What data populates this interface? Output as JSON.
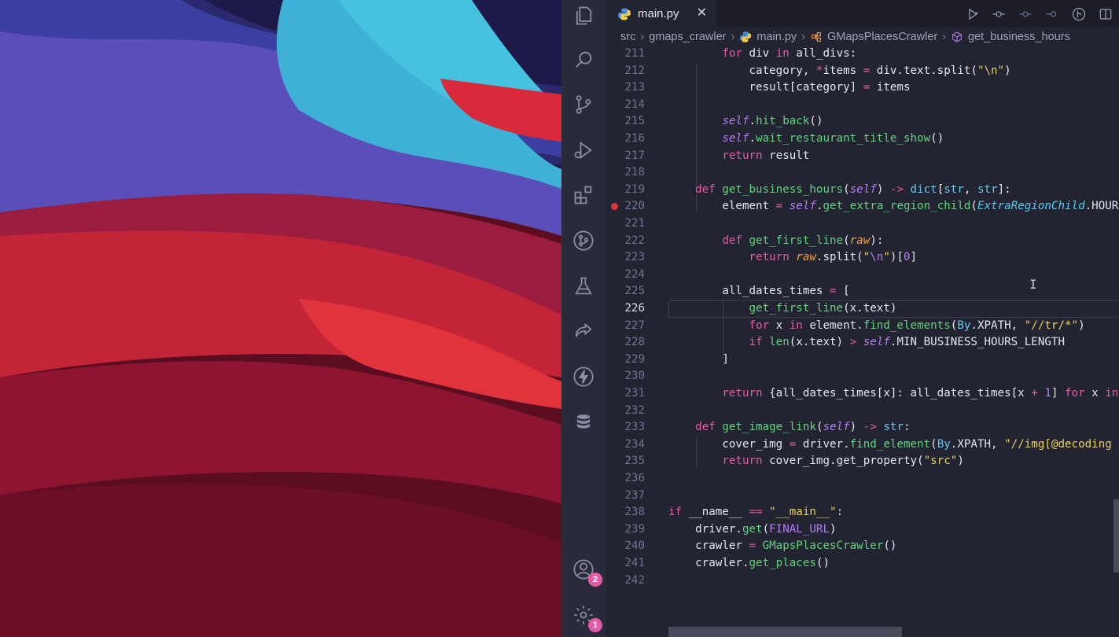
{
  "tab": {
    "label": "main.py",
    "close_glyph": "✕"
  },
  "breadcrumb": [
    "src",
    "gmaps_crawler",
    "main.py",
    "GMapsPlacesCrawler",
    "get_business_hours"
  ],
  "activity_bar": {
    "icons": [
      "explorer-icon",
      "search-icon",
      "source-control-icon",
      "run-debug-icon",
      "extensions-icon",
      "git-graph-icon",
      "testing-icon",
      "live-share-icon",
      "lightning-icon",
      "database-icon"
    ],
    "accounts_badge": "2",
    "settings_badge": "1"
  },
  "editor": {
    "lines": [
      {
        "n": "211",
        "html": "        <span class=\"k\">for</span> div <span class=\"k\">in</span> all_divs:"
      },
      {
        "n": "212",
        "html": "            category, <span class=\"k\">*</span>items <span class=\"k\">=</span> div.text.split(<span class=\"s\">\"\\n\"</span>)"
      },
      {
        "n": "213",
        "html": "            result[category] <span class=\"k\">=</span> items"
      },
      {
        "n": "214",
        "html": ""
      },
      {
        "n": "215",
        "html": "        <span class=\"sf\">self</span>.<span class=\"f\">hit_back</span>()"
      },
      {
        "n": "216",
        "html": "        <span class=\"sf\">self</span>.<span class=\"f\">wait_restaurant_title_show</span>()"
      },
      {
        "n": "217",
        "html": "        <span class=\"k\">return</span> result"
      },
      {
        "n": "218",
        "html": ""
      },
      {
        "n": "219",
        "html": "    <span class=\"k\">def</span> <span class=\"f\">get_business_hours</span>(<span class=\"sf\">self</span>) <span class=\"k\">-&gt;</span> <span class=\"b\">dict</span>[<span class=\"b\">str</span>, <span class=\"b\">str</span>]:"
      },
      {
        "n": "220",
        "html": "        element <span class=\"k\">=</span> <span class=\"sf\">self</span>.<span class=\"f\">get_extra_region_child</span>(<span class=\"cl\">ExtraRegionChild</span>.HOURS)"
      },
      {
        "n": "221",
        "html": ""
      },
      {
        "n": "222",
        "html": "        <span class=\"k\">def</span> <span class=\"f\">get_first_line</span>(<span class=\"pa\">raw</span>):"
      },
      {
        "n": "223",
        "html": "            <span class=\"k\">return</span> <span class=\"pa\">raw</span>.split(<span class=\"s\">\"</span><span class=\"cst\">\\n</span><span class=\"s\">\"</span>)[<span class=\"n\">0</span>]"
      },
      {
        "n": "224",
        "html": ""
      },
      {
        "n": "225",
        "html": "        all_dates_times <span class=\"k\">=</span> ["
      },
      {
        "n": "226",
        "html": "            <span class=\"f\">get_first_line</span>(x.text)"
      },
      {
        "n": "227",
        "html": "            <span class=\"k\">for</span> x <span class=\"k\">in</span> element.<span class=\"f\">find_elements</span>(<span class=\"b\">By</span>.XPATH, <span class=\"s\">\"//tr/*\"</span>)"
      },
      {
        "n": "228",
        "html": "            <span class=\"k\">if</span> <span class=\"f\">len</span>(x.text) <span class=\"k\">&gt;</span> <span class=\"sf\">self</span>.MIN_BUSINESS_HOURS_LENGTH"
      },
      {
        "n": "229",
        "html": "        ]"
      },
      {
        "n": "230",
        "html": ""
      },
      {
        "n": "231",
        "html": "        <span class=\"k\">return</span> {all_dates_times[x]: all_dates_times[x <span class=\"k\">+</span> <span class=\"n\">1</span>] <span class=\"k\">for</span> x <span class=\"k\">in</span>"
      },
      {
        "n": "232",
        "html": ""
      },
      {
        "n": "233",
        "html": "    <span class=\"k\">def</span> <span class=\"f\">get_image_link</span>(<span class=\"sf\">self</span>) <span class=\"k\">-&gt;</span> <span class=\"b\">str</span>:"
      },
      {
        "n": "234",
        "html": "        cover_img <span class=\"k\">=</span> driver.<span class=\"f\">find_element</span>(<span class=\"b\">By</span>.XPATH, <span class=\"s\">\"//img[@decoding</span>"
      },
      {
        "n": "235",
        "html": "        <span class=\"k\">return</span> cover_img.get_property(<span class=\"s\">\"src\"</span>)"
      },
      {
        "n": "236",
        "html": ""
      },
      {
        "n": "237",
        "html": ""
      },
      {
        "n": "238",
        "html": "<span class=\"k\">if</span> __name__ <span class=\"k\">==</span> <span class=\"s\">\"__main__\"</span>:"
      },
      {
        "n": "239",
        "html": "    driver.<span class=\"f\">get</span>(<span class=\"cst\">FINAL_URL</span>)"
      },
      {
        "n": "240",
        "html": "    crawler <span class=\"k\">=</span> <span class=\"g\">GMapsPlacesCrawler</span>()"
      },
      {
        "n": "241",
        "html": "    crawler.<span class=\"f\">get_places</span>()"
      },
      {
        "n": "242",
        "html": ""
      }
    ],
    "active_line": "226",
    "breakpoint_line": "220"
  },
  "colors": {
    "keyword": "#e35ca8",
    "string": "#e8d15a",
    "function": "#62d27d",
    "self": "#b57cf0",
    "builtin": "#66c8ee",
    "param": "#f4a243",
    "badge": "#e35ca8",
    "breakpoint": "#e0323d"
  }
}
